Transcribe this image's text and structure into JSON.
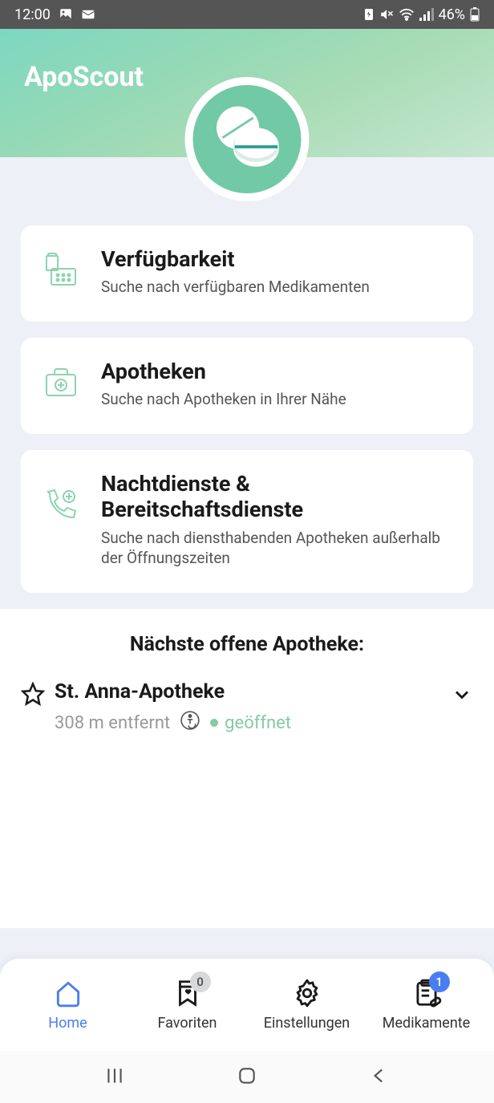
{
  "statusbar": {
    "time": "12:00",
    "battery": "46%"
  },
  "header": {
    "title": "ApoScout"
  },
  "cards": [
    {
      "title": "Verfügbarkeit",
      "description": "Suche nach verfügbaren Medikamenten"
    },
    {
      "title": "Apotheken",
      "description": "Suche nach Apotheken in Ihrer Nähe"
    },
    {
      "title": "Nachtdienste & Bereitschaftsdienste",
      "description": "Suche nach diensthabenden Apotheken außerhalb der Öffnungszeiten"
    }
  ],
  "nearest": {
    "heading": "Nächste offene Apotheke:",
    "name": "St. Anna-Apotheke",
    "distance": "308 m entfernt",
    "status": "geöffnet"
  },
  "nav": {
    "home": "Home",
    "favorites": "Favoriten",
    "favorites_badge": "0",
    "settings": "Einstellungen",
    "meds": "Medikamente",
    "meds_badge": "1"
  }
}
